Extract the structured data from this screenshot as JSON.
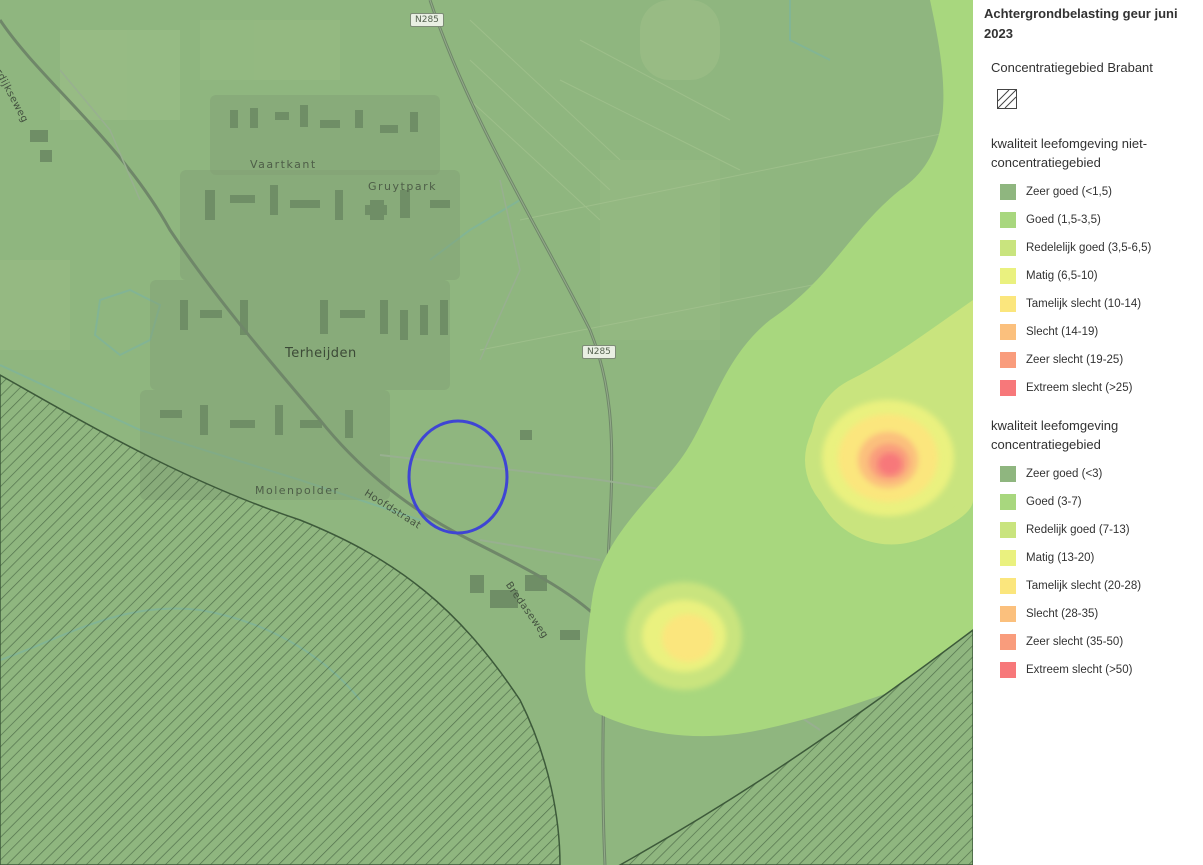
{
  "map": {
    "place_labels": {
      "vaartkant": "Vaartkant",
      "gruytpark": "Gruytpark",
      "terheijden": "Terheijden",
      "molenpolder": "Molenpolder"
    },
    "street_labels": {
      "moerdijkseweg": "Moerdijkseweg",
      "hoofdstraat": "Hoofdstraat",
      "bredaseweg": "Bredaseweg"
    },
    "road_shields": {
      "top": "N285",
      "middle": "N285"
    },
    "marker_color": "#3f45d4"
  },
  "legend": {
    "title": "Achtergrondbelasting geur juni 2023",
    "concentration_area": {
      "title": "Concentratiegebied Brabant",
      "icon": "hatch-pattern-icon"
    },
    "non_concentration": {
      "title": "kwaliteit leefomgeving niet-concentratiegebied",
      "items": [
        {
          "label": "Zeer goed (<1,5)",
          "color": "#8fb67f"
        },
        {
          "label": "Goed (1,5-3,5)",
          "color": "#a8d77e"
        },
        {
          "label": "Redelelijk goed (3,5-6,5)",
          "color": "#c9e47e"
        },
        {
          "label": "Matig (6,5-10)",
          "color": "#eaf17f"
        },
        {
          "label": "Tamelijk slecht (10-14)",
          "color": "#fbe67d"
        },
        {
          "label": "Slecht (14-19)",
          "color": "#fbc07d"
        },
        {
          "label": "Zeer slecht (19-25)",
          "color": "#f99c7c"
        },
        {
          "label": "Extreem slecht (>25)",
          "color": "#f7787a"
        }
      ]
    },
    "concentration": {
      "title": "kwaliteit leefomgeving concentratiegebied",
      "items": [
        {
          "label": "Zeer goed (<3)",
          "color": "#8fb67f"
        },
        {
          "label": "Goed (3-7)",
          "color": "#a8d77e"
        },
        {
          "label": "Redelijk goed (7-13)",
          "color": "#c9e47e"
        },
        {
          "label": "Matig (13-20)",
          "color": "#eaf17f"
        },
        {
          "label": "Tamelijk slecht (20-28)",
          "color": "#fbe67d"
        },
        {
          "label": "Slecht (28-35)",
          "color": "#fbc07d"
        },
        {
          "label": "Zeer slecht (35-50)",
          "color": "#f99c7c"
        },
        {
          "label": "Extreem slecht (>50)",
          "color": "#f7787a"
        }
      ]
    }
  }
}
